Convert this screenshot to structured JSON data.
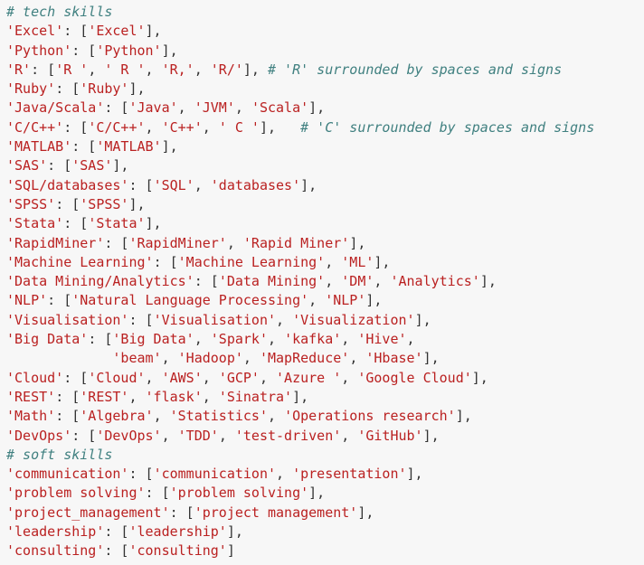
{
  "colors": {
    "background": "#f7f7f7",
    "string": "#ba2121",
    "punctuation": "#333333",
    "comment": "#408080"
  },
  "code_lines": [
    [
      {
        "t": "c",
        "v": "# tech skills"
      }
    ],
    [
      {
        "t": "s",
        "v": "'Excel'"
      },
      {
        "t": "p",
        "v": ": ["
      },
      {
        "t": "s",
        "v": "'Excel'"
      },
      {
        "t": "p",
        "v": "],"
      }
    ],
    [
      {
        "t": "s",
        "v": "'Python'"
      },
      {
        "t": "p",
        "v": ": ["
      },
      {
        "t": "s",
        "v": "'Python'"
      },
      {
        "t": "p",
        "v": "],"
      }
    ],
    [
      {
        "t": "s",
        "v": "'R'"
      },
      {
        "t": "p",
        "v": ": ["
      },
      {
        "t": "s",
        "v": "'R '"
      },
      {
        "t": "p",
        "v": ", "
      },
      {
        "t": "s",
        "v": "' R '"
      },
      {
        "t": "p",
        "v": ", "
      },
      {
        "t": "s",
        "v": "'R,'"
      },
      {
        "t": "p",
        "v": ", "
      },
      {
        "t": "s",
        "v": "'R/'"
      },
      {
        "t": "p",
        "v": "], "
      },
      {
        "t": "c",
        "v": "# 'R' surrounded by spaces and signs"
      }
    ],
    [
      {
        "t": "s",
        "v": "'Ruby'"
      },
      {
        "t": "p",
        "v": ": ["
      },
      {
        "t": "s",
        "v": "'Ruby'"
      },
      {
        "t": "p",
        "v": "],"
      }
    ],
    [
      {
        "t": "s",
        "v": "'Java/Scala'"
      },
      {
        "t": "p",
        "v": ": ["
      },
      {
        "t": "s",
        "v": "'Java'"
      },
      {
        "t": "p",
        "v": ", "
      },
      {
        "t": "s",
        "v": "'JVM'"
      },
      {
        "t": "p",
        "v": ", "
      },
      {
        "t": "s",
        "v": "'Scala'"
      },
      {
        "t": "p",
        "v": "],"
      }
    ],
    [
      {
        "t": "s",
        "v": "'C/C++'"
      },
      {
        "t": "p",
        "v": ": ["
      },
      {
        "t": "s",
        "v": "'C/C++'"
      },
      {
        "t": "p",
        "v": ", "
      },
      {
        "t": "s",
        "v": "'C++'"
      },
      {
        "t": "p",
        "v": ", "
      },
      {
        "t": "s",
        "v": "' C '"
      },
      {
        "t": "p",
        "v": "],   "
      },
      {
        "t": "c",
        "v": "# 'C' surrounded by spaces and signs"
      }
    ],
    [
      {
        "t": "s",
        "v": "'MATLAB'"
      },
      {
        "t": "p",
        "v": ": ["
      },
      {
        "t": "s",
        "v": "'MATLAB'"
      },
      {
        "t": "p",
        "v": "],"
      }
    ],
    [
      {
        "t": "s",
        "v": "'SAS'"
      },
      {
        "t": "p",
        "v": ": ["
      },
      {
        "t": "s",
        "v": "'SAS'"
      },
      {
        "t": "p",
        "v": "],"
      }
    ],
    [
      {
        "t": "s",
        "v": "'SQL/databases'"
      },
      {
        "t": "p",
        "v": ": ["
      },
      {
        "t": "s",
        "v": "'SQL'"
      },
      {
        "t": "p",
        "v": ", "
      },
      {
        "t": "s",
        "v": "'databases'"
      },
      {
        "t": "p",
        "v": "],"
      }
    ],
    [
      {
        "t": "s",
        "v": "'SPSS'"
      },
      {
        "t": "p",
        "v": ": ["
      },
      {
        "t": "s",
        "v": "'SPSS'"
      },
      {
        "t": "p",
        "v": "],"
      }
    ],
    [
      {
        "t": "s",
        "v": "'Stata'"
      },
      {
        "t": "p",
        "v": ": ["
      },
      {
        "t": "s",
        "v": "'Stata'"
      },
      {
        "t": "p",
        "v": "],"
      }
    ],
    [
      {
        "t": "s",
        "v": "'RapidMiner'"
      },
      {
        "t": "p",
        "v": ": ["
      },
      {
        "t": "s",
        "v": "'RapidMiner'"
      },
      {
        "t": "p",
        "v": ", "
      },
      {
        "t": "s",
        "v": "'Rapid Miner'"
      },
      {
        "t": "p",
        "v": "],"
      }
    ],
    [
      {
        "t": "s",
        "v": "'Machine Learning'"
      },
      {
        "t": "p",
        "v": ": ["
      },
      {
        "t": "s",
        "v": "'Machine Learning'"
      },
      {
        "t": "p",
        "v": ", "
      },
      {
        "t": "s",
        "v": "'ML'"
      },
      {
        "t": "p",
        "v": "],"
      }
    ],
    [
      {
        "t": "s",
        "v": "'Data Mining/Analytics'"
      },
      {
        "t": "p",
        "v": ": ["
      },
      {
        "t": "s",
        "v": "'Data Mining'"
      },
      {
        "t": "p",
        "v": ", "
      },
      {
        "t": "s",
        "v": "'DM'"
      },
      {
        "t": "p",
        "v": ", "
      },
      {
        "t": "s",
        "v": "'Analytics'"
      },
      {
        "t": "p",
        "v": "],"
      }
    ],
    [
      {
        "t": "s",
        "v": "'NLP'"
      },
      {
        "t": "p",
        "v": ": ["
      },
      {
        "t": "s",
        "v": "'Natural Language Processing'"
      },
      {
        "t": "p",
        "v": ", "
      },
      {
        "t": "s",
        "v": "'NLP'"
      },
      {
        "t": "p",
        "v": "],"
      }
    ],
    [
      {
        "t": "s",
        "v": "'Visualisation'"
      },
      {
        "t": "p",
        "v": ": ["
      },
      {
        "t": "s",
        "v": "'Visualisation'"
      },
      {
        "t": "p",
        "v": ", "
      },
      {
        "t": "s",
        "v": "'Visualization'"
      },
      {
        "t": "p",
        "v": "],"
      }
    ],
    [
      {
        "t": "s",
        "v": "'Big Data'"
      },
      {
        "t": "p",
        "v": ": ["
      },
      {
        "t": "s",
        "v": "'Big Data'"
      },
      {
        "t": "p",
        "v": ", "
      },
      {
        "t": "s",
        "v": "'Spark'"
      },
      {
        "t": "p",
        "v": ", "
      },
      {
        "t": "s",
        "v": "'kafka'"
      },
      {
        "t": "p",
        "v": ", "
      },
      {
        "t": "s",
        "v": "'Hive'"
      },
      {
        "t": "p",
        "v": ","
      }
    ],
    [
      {
        "t": "p",
        "v": "             "
      },
      {
        "t": "s",
        "v": "'beam'"
      },
      {
        "t": "p",
        "v": ", "
      },
      {
        "t": "s",
        "v": "'Hadoop'"
      },
      {
        "t": "p",
        "v": ", "
      },
      {
        "t": "s",
        "v": "'MapReduce'"
      },
      {
        "t": "p",
        "v": ", "
      },
      {
        "t": "s",
        "v": "'Hbase'"
      },
      {
        "t": "p",
        "v": "],"
      }
    ],
    [
      {
        "t": "s",
        "v": "'Cloud'"
      },
      {
        "t": "p",
        "v": ": ["
      },
      {
        "t": "s",
        "v": "'Cloud'"
      },
      {
        "t": "p",
        "v": ", "
      },
      {
        "t": "s",
        "v": "'AWS'"
      },
      {
        "t": "p",
        "v": ", "
      },
      {
        "t": "s",
        "v": "'GCP'"
      },
      {
        "t": "p",
        "v": ", "
      },
      {
        "t": "s",
        "v": "'Azure '"
      },
      {
        "t": "p",
        "v": ", "
      },
      {
        "t": "s",
        "v": "'Google Cloud'"
      },
      {
        "t": "p",
        "v": "],"
      }
    ],
    [
      {
        "t": "s",
        "v": "'REST'"
      },
      {
        "t": "p",
        "v": ": ["
      },
      {
        "t": "s",
        "v": "'REST'"
      },
      {
        "t": "p",
        "v": ", "
      },
      {
        "t": "s",
        "v": "'flask'"
      },
      {
        "t": "p",
        "v": ", "
      },
      {
        "t": "s",
        "v": "'Sinatra'"
      },
      {
        "t": "p",
        "v": "],"
      }
    ],
    [
      {
        "t": "s",
        "v": "'Math'"
      },
      {
        "t": "p",
        "v": ": ["
      },
      {
        "t": "s",
        "v": "'Algebra'"
      },
      {
        "t": "p",
        "v": ", "
      },
      {
        "t": "s",
        "v": "'Statistics'"
      },
      {
        "t": "p",
        "v": ", "
      },
      {
        "t": "s",
        "v": "'Operations research'"
      },
      {
        "t": "p",
        "v": "],"
      }
    ],
    [
      {
        "t": "s",
        "v": "'DevOps'"
      },
      {
        "t": "p",
        "v": ": ["
      },
      {
        "t": "s",
        "v": "'DevOps'"
      },
      {
        "t": "p",
        "v": ", "
      },
      {
        "t": "s",
        "v": "'TDD'"
      },
      {
        "t": "p",
        "v": ", "
      },
      {
        "t": "s",
        "v": "'test-driven'"
      },
      {
        "t": "p",
        "v": ", "
      },
      {
        "t": "s",
        "v": "'GitHub'"
      },
      {
        "t": "p",
        "v": "],"
      }
    ],
    [
      {
        "t": "c",
        "v": "# soft skills"
      }
    ],
    [
      {
        "t": "s",
        "v": "'communication'"
      },
      {
        "t": "p",
        "v": ": ["
      },
      {
        "t": "s",
        "v": "'communication'"
      },
      {
        "t": "p",
        "v": ", "
      },
      {
        "t": "s",
        "v": "'presentation'"
      },
      {
        "t": "p",
        "v": "],"
      }
    ],
    [
      {
        "t": "s",
        "v": "'problem solving'"
      },
      {
        "t": "p",
        "v": ": ["
      },
      {
        "t": "s",
        "v": "'problem solving'"
      },
      {
        "t": "p",
        "v": "],"
      }
    ],
    [
      {
        "t": "s",
        "v": "'project_management'"
      },
      {
        "t": "p",
        "v": ": ["
      },
      {
        "t": "s",
        "v": "'project management'"
      },
      {
        "t": "p",
        "v": "],"
      }
    ],
    [
      {
        "t": "s",
        "v": "'leadership'"
      },
      {
        "t": "p",
        "v": ": ["
      },
      {
        "t": "s",
        "v": "'leadership'"
      },
      {
        "t": "p",
        "v": "],"
      }
    ],
    [
      {
        "t": "s",
        "v": "'consulting'"
      },
      {
        "t": "p",
        "v": ": ["
      },
      {
        "t": "s",
        "v": "'consulting'"
      },
      {
        "t": "p",
        "v": "]"
      }
    ]
  ]
}
